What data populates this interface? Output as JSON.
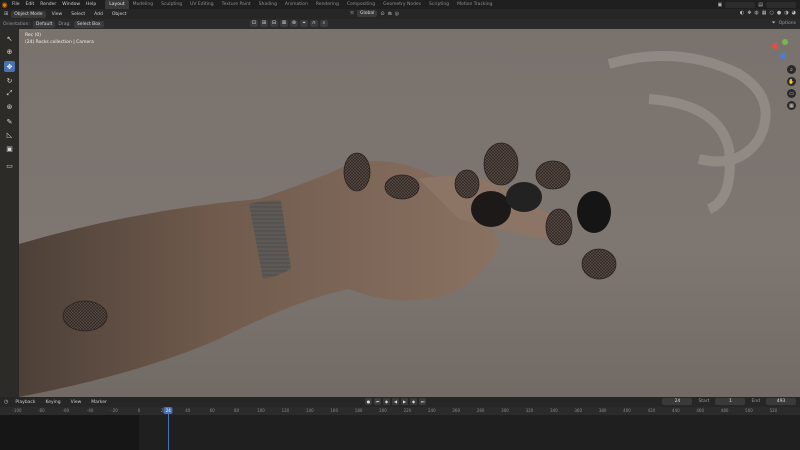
{
  "topbar": {
    "menu": [
      "File",
      "Edit",
      "Render",
      "Window",
      "Help"
    ],
    "workspaces": [
      "Layout",
      "Modeling",
      "Sculpting",
      "UV Editing",
      "Texture Paint",
      "Shading",
      "Animation",
      "Rendering",
      "Compositing",
      "Geometry Nodes",
      "Scripting",
      "Motion Tracking"
    ],
    "active_workspace": "Layout"
  },
  "header": {
    "mode": "Object Mode",
    "menus": [
      "View",
      "Select",
      "Add",
      "Object"
    ],
    "transform_orientation": "Global"
  },
  "toolsettings": {
    "orientation_label": "Orientation:",
    "orientation_value": "Default",
    "drag_label": "Drag:",
    "drag_value": "Select Box",
    "options_label": "Options"
  },
  "viewport": {
    "info_line1": "Rec (0)",
    "info_line2": "(24) Rocks collection | Camera",
    "background_color": "#7d7570"
  },
  "timeline": {
    "menus": [
      "Playback",
      "Keying",
      "View",
      "Marker"
    ],
    "current_frame": "24",
    "start_label": "Start",
    "start_value": "1",
    "end_label": "End",
    "end_value": "493",
    "ruler": [
      "-100",
      "-80",
      "-60",
      "-40",
      "-20",
      "0",
      "20",
      "40",
      "60",
      "80",
      "100",
      "120",
      "140",
      "160",
      "180",
      "200",
      "220",
      "240",
      "260",
      "280",
      "300",
      "320",
      "340",
      "360",
      "380",
      "400",
      "420",
      "440",
      "460",
      "480",
      "500",
      "520"
    ],
    "playhead_label": "24"
  },
  "accent_color": "#4772b3"
}
